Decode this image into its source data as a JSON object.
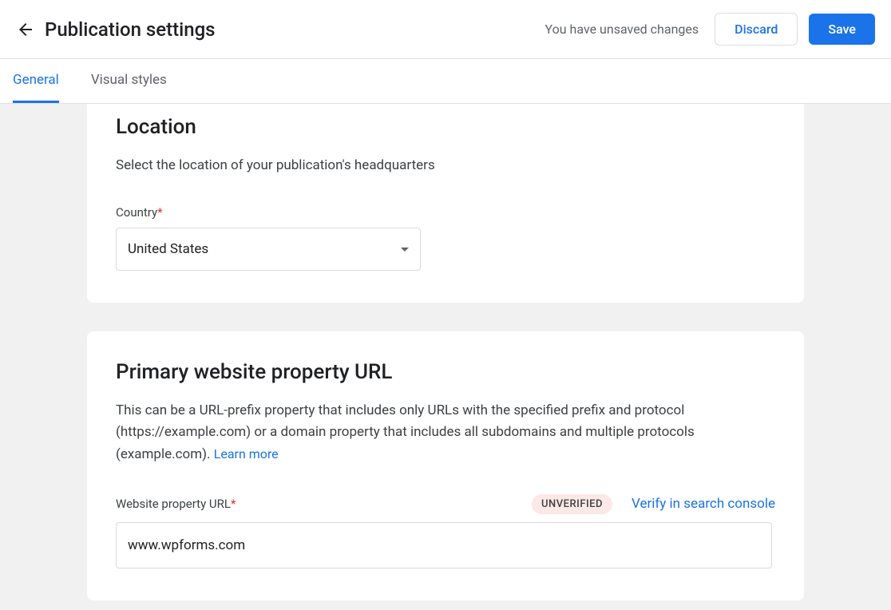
{
  "header": {
    "title": "Publication settings",
    "unsaved_message": "You have unsaved changes",
    "discard_label": "Discard",
    "save_label": "Save"
  },
  "tabs": {
    "general": "General",
    "visual_styles": "Visual styles"
  },
  "location_card": {
    "title": "Location",
    "description": "Select the location of your publication's headquarters",
    "country_label": "Country",
    "country_value": "United States"
  },
  "url_card": {
    "title": "Primary website property URL",
    "description": "This can be a URL-prefix property that includes only URLs with the specified prefix and protocol (https://example.com) or a domain property that includes all subdomains and multiple protocols (example.com). ",
    "learn_more": "Learn more",
    "url_label": "Website property URL",
    "badge": "UNVERIFIED",
    "verify_link": "Verify in search console",
    "url_value": "www.wpforms.com"
  }
}
